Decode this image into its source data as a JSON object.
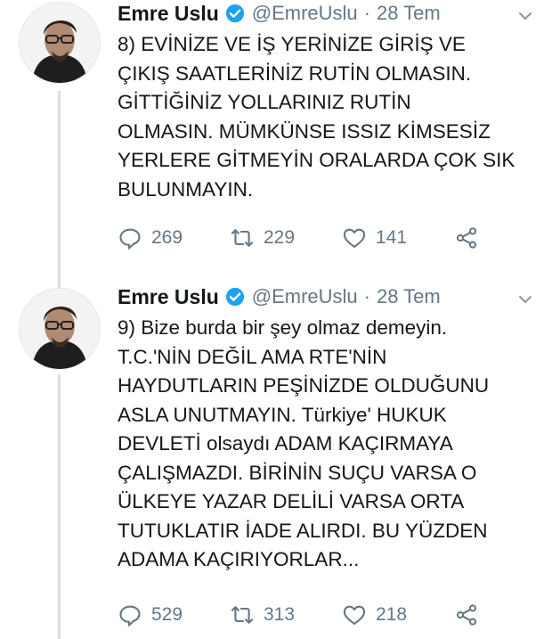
{
  "tweets": [
    {
      "name": "Emre Uslu",
      "handle": "@EmreUslu",
      "separator": "·",
      "date": "28 Tem",
      "text": "8) EVİNİZE VE İŞ YERİNİZE GİRİŞ VE\nÇIKIŞ SAATLERİNİZ RUTİN OLMASIN.\nGİTTİĞİNİZ YOLLARINIZ RUTİN\nOLMASIN. MÜMKÜNSE ISSIZ KİMSESİZ\nYERLERE GİTMEYİN ORALARDA ÇOK SIK\nBULUNMAYIN.",
      "replies": "269",
      "retweets": "229",
      "likes": "141"
    },
    {
      "name": "Emre Uslu",
      "handle": "@EmreUslu",
      "separator": "·",
      "date": "28 Tem",
      "text": "9) Bize burda bir şey olmaz demeyin.\nT.C.'NİN DEĞİL AMA RTE'NİN\nHAYDUTLARIN PEŞİNİZDE OLDUĞUNU\nASLA UNUTMAYIN. Türkiye' HUKUK\nDEVLETİ olsaydı ADAM KAÇIRMAYA\nÇALIŞMAZDI. BİRİNİN SUÇU VARSA O\nÜLKEYE YAZAR DELİLİ VARSA ORTA\nTUTUKLATIR İADE ALIRDI. BU YÜZDEN\nADAMA KAÇIRIYORLAR...",
      "replies": "529",
      "retweets": "313",
      "likes": "218"
    }
  ],
  "icons": {
    "verified": "verified-badge-icon",
    "reply": "reply-icon",
    "retweet": "retweet-icon",
    "like": "heart-icon",
    "share": "share-icon",
    "caret": "chevron-down-icon"
  },
  "colors": {
    "verified": "#1da1f2",
    "muted": "#657786",
    "text": "#14171a"
  }
}
